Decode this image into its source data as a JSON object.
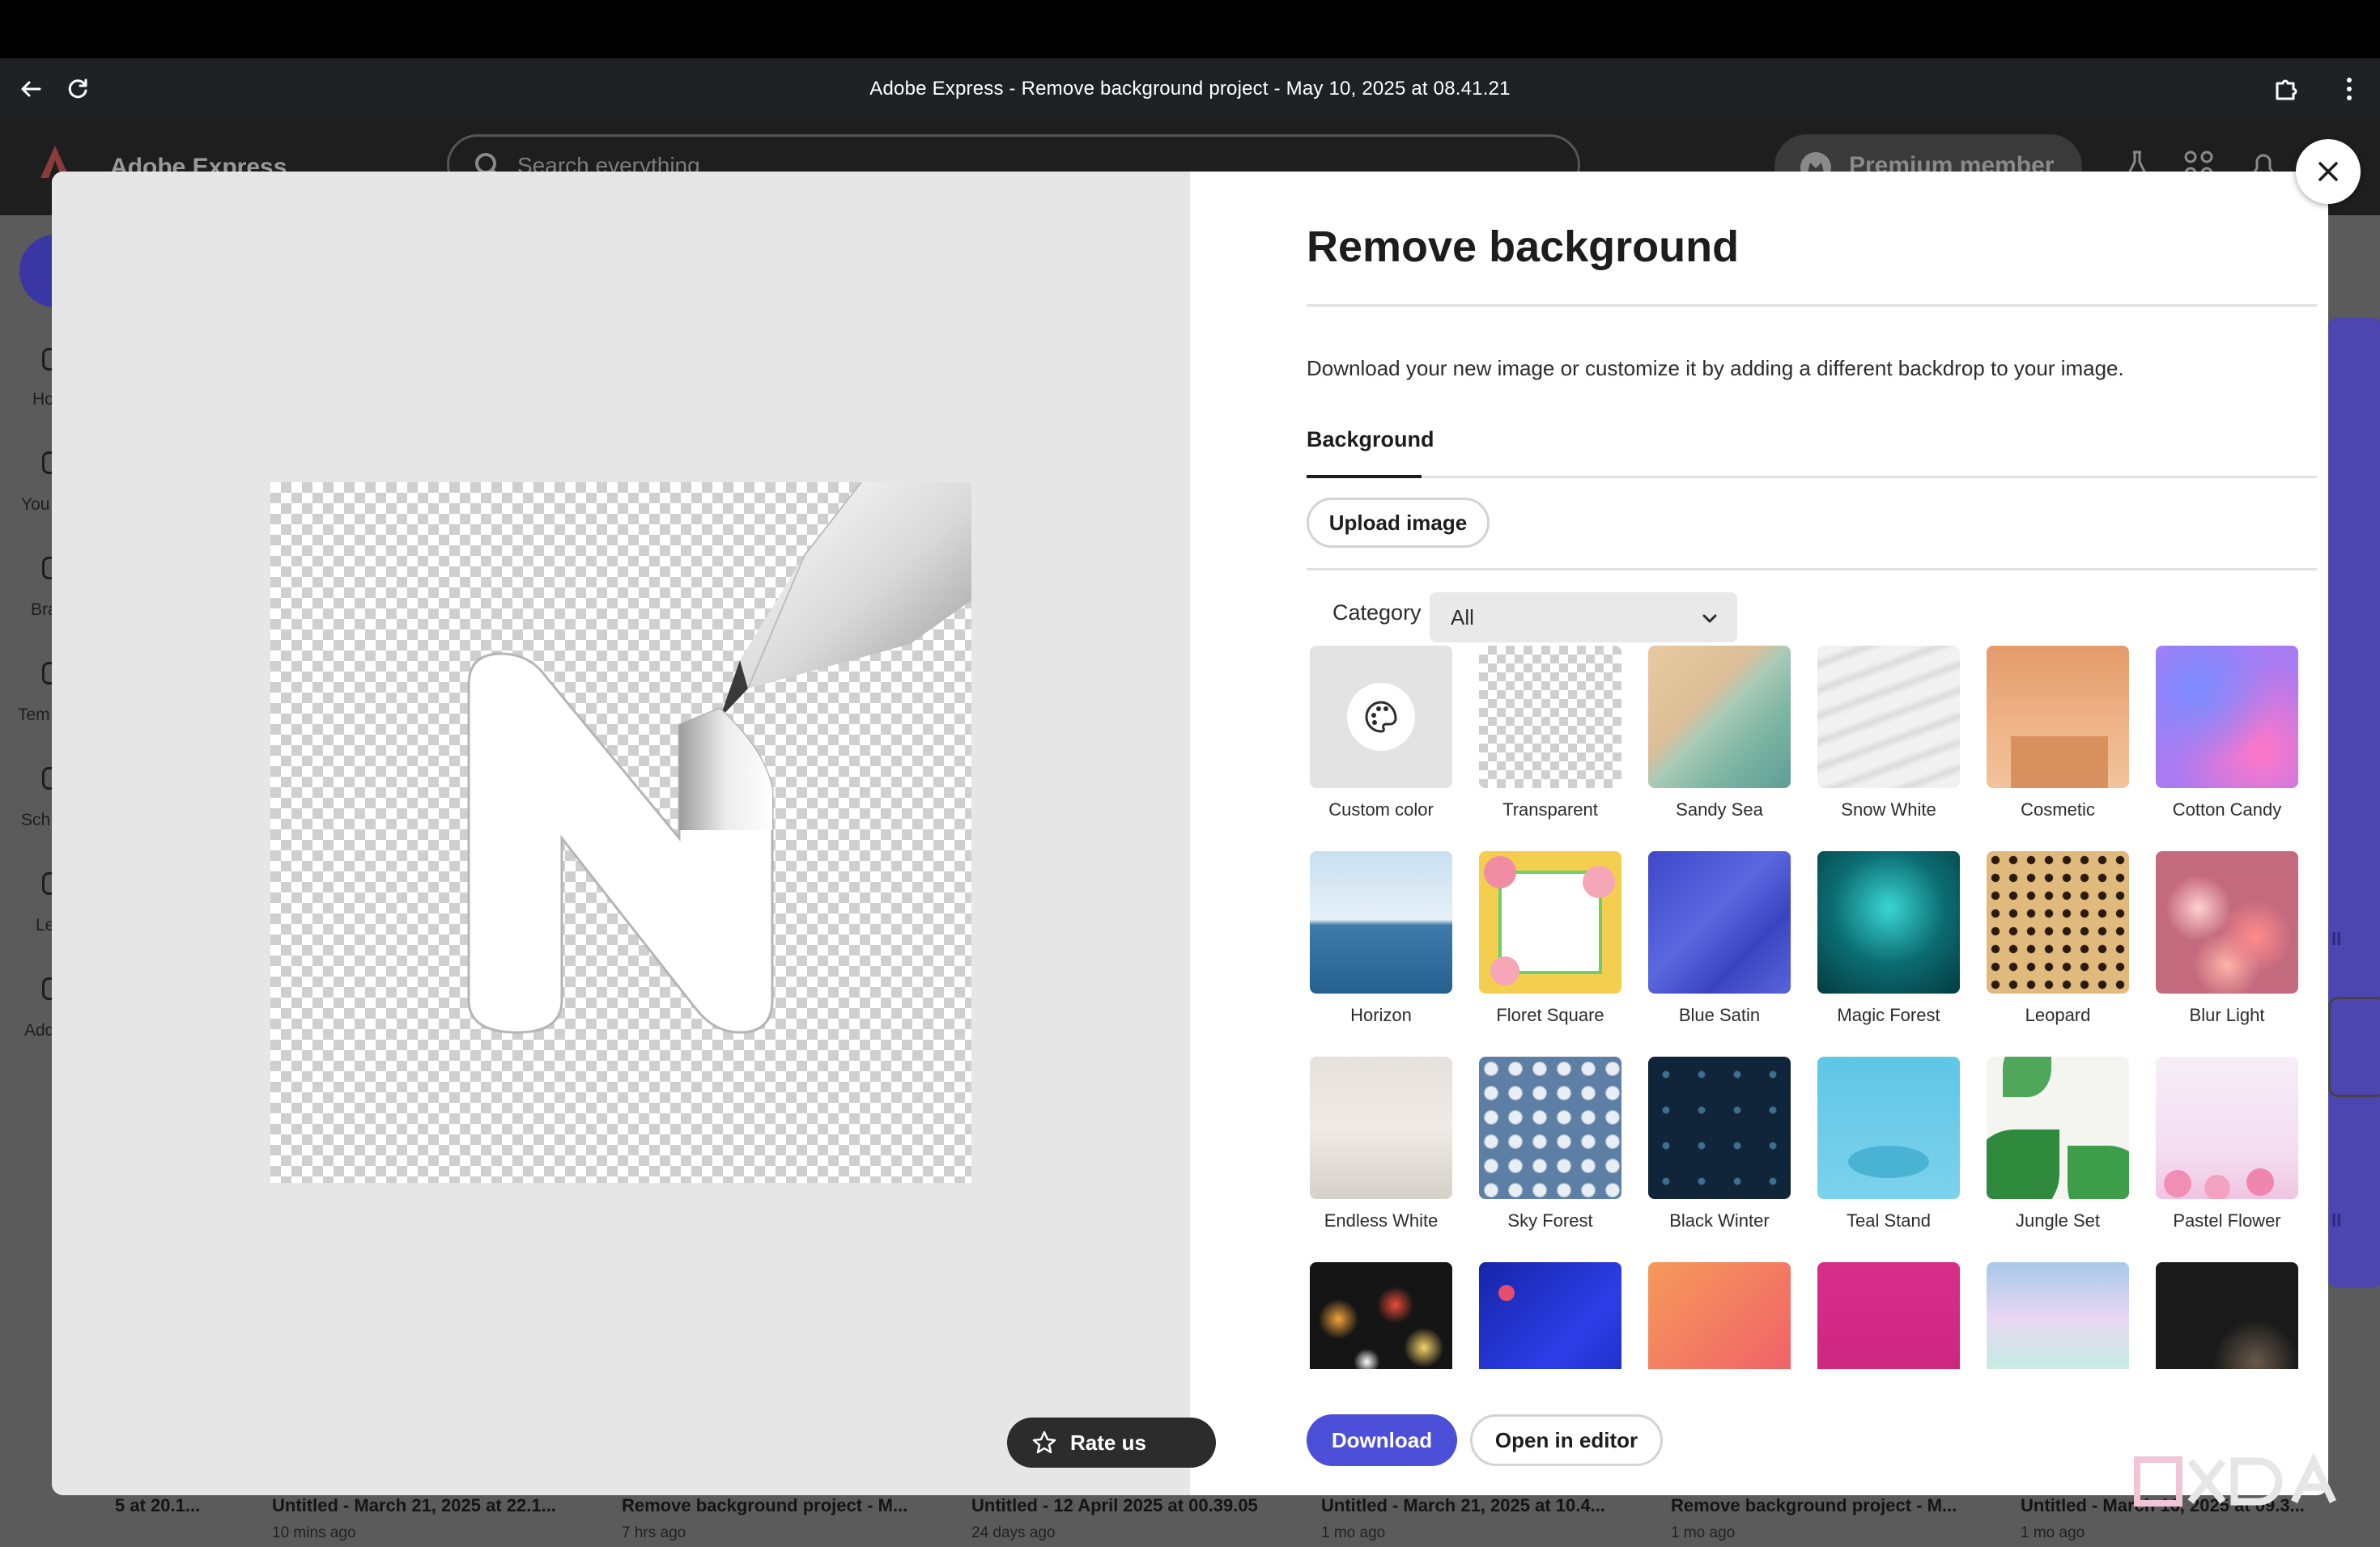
{
  "browser": {
    "window_title": "Adobe Express - Remove background project - May 10, 2025 at 08.41.21"
  },
  "app": {
    "name": "Adobe Express",
    "search_placeholder": "Search everything",
    "premium_label": "Premium member",
    "sidebar_items": [
      "Ho",
      "You",
      "Bra",
      "Tem",
      "Sch",
      "Le",
      "Add"
    ],
    "right_links": [
      "ll",
      "ll"
    ],
    "recent_files": [
      {
        "title": "5 at 20.1...",
        "subtitle": ""
      },
      {
        "title": "Untitled - March 21, 2025 at 22.1...",
        "subtitle": "10 mins ago"
      },
      {
        "title": "Remove background project - M...",
        "subtitle": "7 hrs ago"
      },
      {
        "title": "Untitled - 12 April 2025 at 00.39.05",
        "subtitle": "24 days ago"
      },
      {
        "title": "Untitled - March 21, 2025 at 10.4...",
        "subtitle": "1 mo ago"
      },
      {
        "title": "Remove background project - M...",
        "subtitle": "1 mo ago"
      },
      {
        "title": "Untitled - March 16, 2025 at 09.3...",
        "subtitle": "1 mo ago"
      }
    ]
  },
  "modal": {
    "title": "Remove background",
    "description": "Download your new image or customize it by adding a different backdrop to your image.",
    "tab_label": "Background",
    "upload_label": "Upload image",
    "category_label": "Category",
    "category_value": "All",
    "backgrounds": [
      {
        "label": "Custom color",
        "icon": "palette-icon"
      },
      {
        "label": "Transparent"
      },
      {
        "label": "Sandy Sea"
      },
      {
        "label": "Snow White"
      },
      {
        "label": "Cosmetic"
      },
      {
        "label": "Cotton Candy"
      },
      {
        "label": "Horizon"
      },
      {
        "label": "Floret Square"
      },
      {
        "label": "Blue Satin"
      },
      {
        "label": "Magic Forest"
      },
      {
        "label": "Leopard"
      },
      {
        "label": "Blur Light"
      },
      {
        "label": "Endless White"
      },
      {
        "label": "Sky Forest"
      },
      {
        "label": "Black Winter"
      },
      {
        "label": "Teal Stand"
      },
      {
        "label": "Jungle Set"
      },
      {
        "label": "Pastel Flower"
      },
      {
        "label": ""
      },
      {
        "label": ""
      },
      {
        "label": ""
      },
      {
        "label": ""
      },
      {
        "label": ""
      },
      {
        "label": ""
      }
    ],
    "download_label": "Download",
    "open_editor_label": "Open in editor",
    "rate_label": "Rate us"
  },
  "colors": {
    "accent": "#4c4fd8",
    "preview_bg": "#e6e6e6",
    "dark_button": "#2c2c2c"
  }
}
